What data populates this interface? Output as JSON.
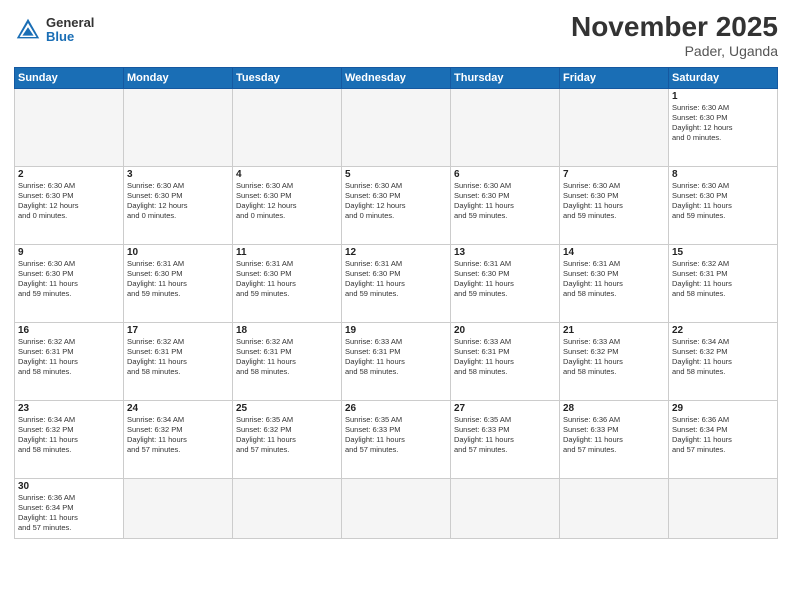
{
  "header": {
    "logo_general": "General",
    "logo_blue": "Blue",
    "month_title": "November 2025",
    "location": "Pader, Uganda"
  },
  "days_of_week": [
    "Sunday",
    "Monday",
    "Tuesday",
    "Wednesday",
    "Thursday",
    "Friday",
    "Saturday"
  ],
  "weeks": [
    [
      {
        "day": "",
        "info": ""
      },
      {
        "day": "",
        "info": ""
      },
      {
        "day": "",
        "info": ""
      },
      {
        "day": "",
        "info": ""
      },
      {
        "day": "",
        "info": ""
      },
      {
        "day": "",
        "info": ""
      },
      {
        "day": "1",
        "info": "Sunrise: 6:30 AM\nSunset: 6:30 PM\nDaylight: 12 hours\nand 0 minutes."
      }
    ],
    [
      {
        "day": "2",
        "info": "Sunrise: 6:30 AM\nSunset: 6:30 PM\nDaylight: 12 hours\nand 0 minutes."
      },
      {
        "day": "3",
        "info": "Sunrise: 6:30 AM\nSunset: 6:30 PM\nDaylight: 12 hours\nand 0 minutes."
      },
      {
        "day": "4",
        "info": "Sunrise: 6:30 AM\nSunset: 6:30 PM\nDaylight: 12 hours\nand 0 minutes."
      },
      {
        "day": "5",
        "info": "Sunrise: 6:30 AM\nSunset: 6:30 PM\nDaylight: 12 hours\nand 0 minutes."
      },
      {
        "day": "6",
        "info": "Sunrise: 6:30 AM\nSunset: 6:30 PM\nDaylight: 11 hours\nand 59 minutes."
      },
      {
        "day": "7",
        "info": "Sunrise: 6:30 AM\nSunset: 6:30 PM\nDaylight: 11 hours\nand 59 minutes."
      },
      {
        "day": "8",
        "info": "Sunrise: 6:30 AM\nSunset: 6:30 PM\nDaylight: 11 hours\nand 59 minutes."
      }
    ],
    [
      {
        "day": "9",
        "info": "Sunrise: 6:30 AM\nSunset: 6:30 PM\nDaylight: 11 hours\nand 59 minutes."
      },
      {
        "day": "10",
        "info": "Sunrise: 6:31 AM\nSunset: 6:30 PM\nDaylight: 11 hours\nand 59 minutes."
      },
      {
        "day": "11",
        "info": "Sunrise: 6:31 AM\nSunset: 6:30 PM\nDaylight: 11 hours\nand 59 minutes."
      },
      {
        "day": "12",
        "info": "Sunrise: 6:31 AM\nSunset: 6:30 PM\nDaylight: 11 hours\nand 59 minutes."
      },
      {
        "day": "13",
        "info": "Sunrise: 6:31 AM\nSunset: 6:30 PM\nDaylight: 11 hours\nand 59 minutes."
      },
      {
        "day": "14",
        "info": "Sunrise: 6:31 AM\nSunset: 6:30 PM\nDaylight: 11 hours\nand 58 minutes."
      },
      {
        "day": "15",
        "info": "Sunrise: 6:32 AM\nSunset: 6:31 PM\nDaylight: 11 hours\nand 58 minutes."
      }
    ],
    [
      {
        "day": "16",
        "info": "Sunrise: 6:32 AM\nSunset: 6:31 PM\nDaylight: 11 hours\nand 58 minutes."
      },
      {
        "day": "17",
        "info": "Sunrise: 6:32 AM\nSunset: 6:31 PM\nDaylight: 11 hours\nand 58 minutes."
      },
      {
        "day": "18",
        "info": "Sunrise: 6:32 AM\nSunset: 6:31 PM\nDaylight: 11 hours\nand 58 minutes."
      },
      {
        "day": "19",
        "info": "Sunrise: 6:33 AM\nSunset: 6:31 PM\nDaylight: 11 hours\nand 58 minutes."
      },
      {
        "day": "20",
        "info": "Sunrise: 6:33 AM\nSunset: 6:31 PM\nDaylight: 11 hours\nand 58 minutes."
      },
      {
        "day": "21",
        "info": "Sunrise: 6:33 AM\nSunset: 6:32 PM\nDaylight: 11 hours\nand 58 minutes."
      },
      {
        "day": "22",
        "info": "Sunrise: 6:34 AM\nSunset: 6:32 PM\nDaylight: 11 hours\nand 58 minutes."
      }
    ],
    [
      {
        "day": "23",
        "info": "Sunrise: 6:34 AM\nSunset: 6:32 PM\nDaylight: 11 hours\nand 58 minutes."
      },
      {
        "day": "24",
        "info": "Sunrise: 6:34 AM\nSunset: 6:32 PM\nDaylight: 11 hours\nand 57 minutes."
      },
      {
        "day": "25",
        "info": "Sunrise: 6:35 AM\nSunset: 6:32 PM\nDaylight: 11 hours\nand 57 minutes."
      },
      {
        "day": "26",
        "info": "Sunrise: 6:35 AM\nSunset: 6:33 PM\nDaylight: 11 hours\nand 57 minutes."
      },
      {
        "day": "27",
        "info": "Sunrise: 6:35 AM\nSunset: 6:33 PM\nDaylight: 11 hours\nand 57 minutes."
      },
      {
        "day": "28",
        "info": "Sunrise: 6:36 AM\nSunset: 6:33 PM\nDaylight: 11 hours\nand 57 minutes."
      },
      {
        "day": "29",
        "info": "Sunrise: 6:36 AM\nSunset: 6:34 PM\nDaylight: 11 hours\nand 57 minutes."
      }
    ],
    [
      {
        "day": "30",
        "info": "Sunrise: 6:36 AM\nSunset: 6:34 PM\nDaylight: 11 hours\nand 57 minutes."
      },
      {
        "day": "",
        "info": ""
      },
      {
        "day": "",
        "info": ""
      },
      {
        "day": "",
        "info": ""
      },
      {
        "day": "",
        "info": ""
      },
      {
        "day": "",
        "info": ""
      },
      {
        "day": "",
        "info": ""
      }
    ]
  ]
}
